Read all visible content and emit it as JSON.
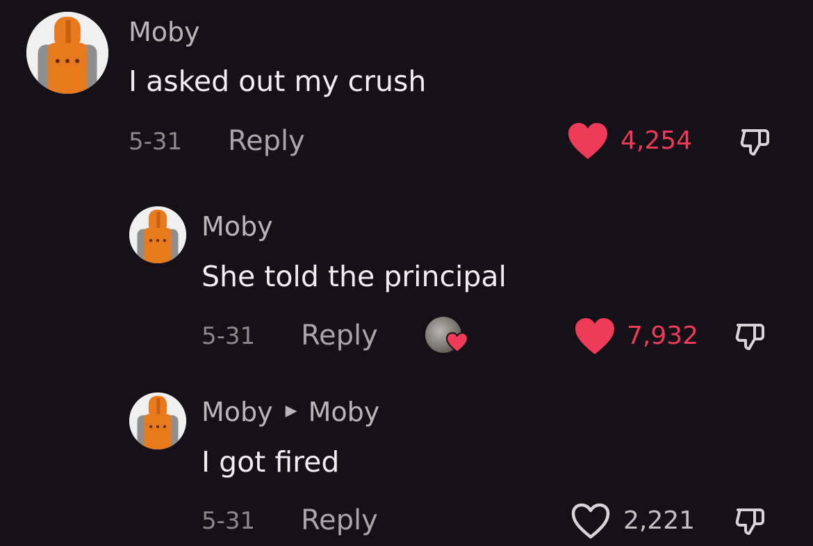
{
  "colors": {
    "background": "#161118",
    "liked_heart": "#ee3b58",
    "avatar_robot": "#e87a1e"
  },
  "comments": [
    {
      "username": "Moby",
      "text": "I asked out my crush",
      "date": "5-31",
      "reply_label": "Reply",
      "likes": "4,254",
      "liked": true,
      "heart_icon": "heart-filled-icon",
      "dislike_icon": "thumbs-down-icon"
    },
    {
      "username": "Moby",
      "text": "She told the principal",
      "date": "5-31",
      "reply_label": "Reply",
      "likes": "7,932",
      "liked": true,
      "creator_liked": true,
      "heart_icon": "heart-filled-icon",
      "dislike_icon": "thumbs-down-icon"
    },
    {
      "username": "Moby",
      "reply_to": "Moby",
      "text": "I got fired",
      "date": "5-31",
      "reply_label": "Reply",
      "likes": "2,221",
      "liked": false,
      "heart_icon": "heart-outline-icon",
      "dislike_icon": "thumbs-down-icon"
    }
  ]
}
